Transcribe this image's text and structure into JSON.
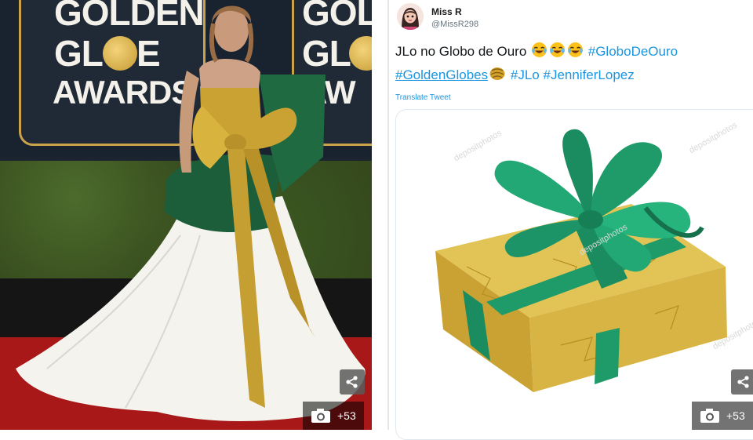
{
  "photo": {
    "banner_left": {
      "line1": "GOLDEN",
      "line2": "GL  BE",
      "line3": "AWARDS"
    },
    "banner_right": {
      "line1": "GOLD",
      "line2": "GL",
      "line3": "AW"
    },
    "photo_count": "+53"
  },
  "tweet": {
    "display_name": "Miss R",
    "handle": "@MissR298",
    "text_intro": "JLo no Globo de Ouro",
    "hashtags": [
      "#GloboDeOuro",
      "#GoldenGlobes",
      "#JLo",
      "#JenniferLopez"
    ],
    "translate_label": "Translate Tweet",
    "watermark_text": "depositphotos",
    "photo_count": "+53"
  },
  "colors": {
    "link": "#1b95e0",
    "ribbon_green": "#1f9b6a",
    "gift_gold": "#d6b23d",
    "carpet_red": "#a81818"
  }
}
